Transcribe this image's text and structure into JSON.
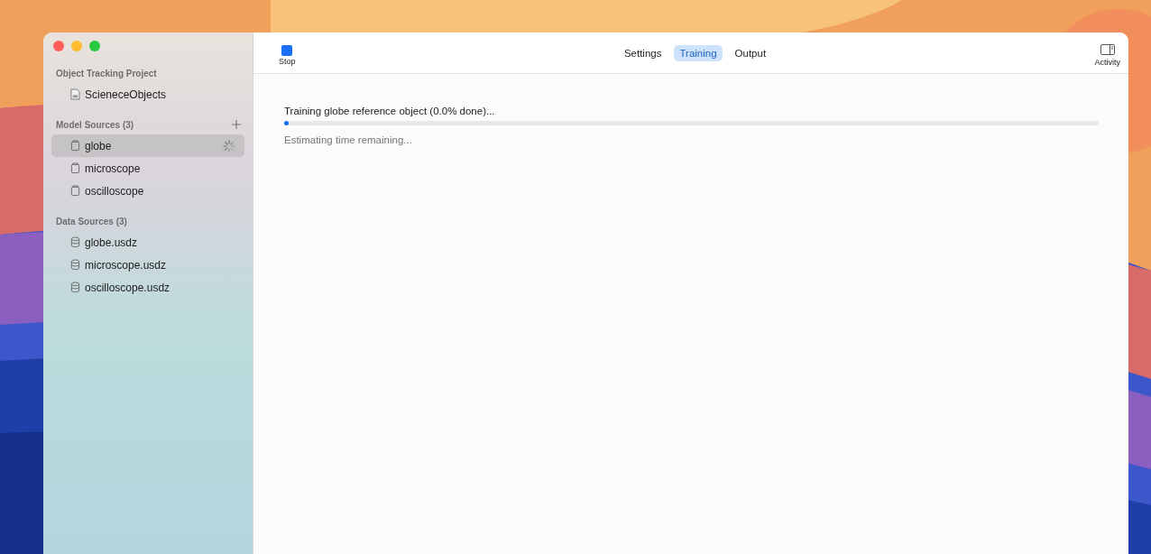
{
  "sidebar": {
    "sections": [
      {
        "title": "Object Tracking Project",
        "addable": false,
        "items": [
          {
            "label": "ScieneceObjects",
            "kind": "ml-file",
            "selected": false,
            "busy": false
          }
        ]
      },
      {
        "title": "Model Sources (3)",
        "addable": true,
        "items": [
          {
            "label": "globe",
            "kind": "model",
            "selected": true,
            "busy": true
          },
          {
            "label": "microscope",
            "kind": "model",
            "selected": false,
            "busy": false
          },
          {
            "label": "oscilloscope",
            "kind": "model",
            "selected": false,
            "busy": false
          }
        ]
      },
      {
        "title": "Data Sources (3)",
        "addable": false,
        "items": [
          {
            "label": "globe.usdz",
            "kind": "data",
            "selected": false,
            "busy": false
          },
          {
            "label": "microscope.usdz",
            "kind": "data",
            "selected": false,
            "busy": false
          },
          {
            "label": "oscilloscope.usdz",
            "kind": "data",
            "selected": false,
            "busy": false
          }
        ]
      }
    ]
  },
  "toolbar": {
    "stop": "Stop",
    "tabs": [
      {
        "label": "Settings",
        "selected": false
      },
      {
        "label": "Training",
        "selected": true
      },
      {
        "label": "Output",
        "selected": false
      }
    ],
    "activity": "Activity"
  },
  "training": {
    "status": "Training globe reference object (0.0% done)...",
    "level": 0.005,
    "remaining": "Estimating time remaining..."
  }
}
